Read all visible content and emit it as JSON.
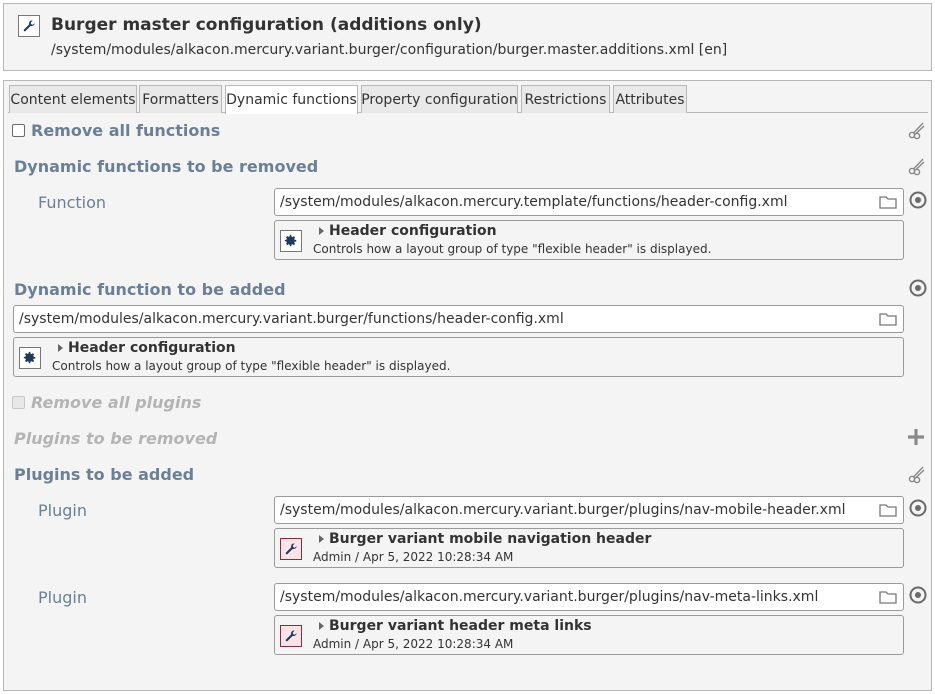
{
  "header": {
    "title": "Burger master configuration (additions only)",
    "path": "/system/modules/alkacon.mercury.variant.burger/configuration/burger.master.additions.xml [en]",
    "icon": "wrench-icon"
  },
  "tabs": [
    {
      "label": "Content elements",
      "active": false
    },
    {
      "label": "Formatters",
      "active": false
    },
    {
      "label": "Dynamic functions",
      "active": true
    },
    {
      "label": "Property configuration",
      "active": false
    },
    {
      "label": "Restrictions",
      "active": false
    },
    {
      "label": "Attributes",
      "active": false
    }
  ],
  "form": {
    "remove_all_functions": {
      "label": "Remove all functions",
      "checked": false
    },
    "functions_removed": {
      "label": "Dynamic functions to be removed",
      "field_label": "Function",
      "value": "/system/modules/alkacon.mercury.template/functions/header-config.xml",
      "preview_title": "Header configuration",
      "preview_sub": "Controls how a layout group of type \"flexible header\" is displayed.",
      "preview_icon": "gear-icon"
    },
    "function_added": {
      "label": "Dynamic function to be added",
      "value": "/system/modules/alkacon.mercury.variant.burger/functions/header-config.xml",
      "preview_title": "Header configuration",
      "preview_sub": "Controls how a layout group of type \"flexible header\" is displayed.",
      "preview_icon": "gear-icon"
    },
    "remove_all_plugins": {
      "label": "Remove all plugins",
      "checked": false,
      "disabled": true
    },
    "plugins_removed": {
      "label": "Plugins to be removed",
      "disabled": true
    },
    "plugins_added": {
      "label": "Plugins to be added",
      "items": [
        {
          "field_label": "Plugin",
          "value": "/system/modules/alkacon.mercury.variant.burger/plugins/nav-mobile-header.xml",
          "preview_title": "Burger variant mobile navigation header",
          "preview_sub": "Admin / Apr 5, 2022 10:28:34 AM",
          "preview_icon": "wrench-icon"
        },
        {
          "field_label": "Plugin",
          "value": "/system/modules/alkacon.mercury.variant.burger/plugins/nav-meta-links.xml",
          "preview_title": "Burger variant header meta links",
          "preview_sub": "Admin / Apr 5, 2022 10:28:34 AM",
          "preview_icon": "wrench-icon"
        }
      ]
    }
  },
  "colors": {
    "label_blue": "#6b7f96",
    "panel_bg": "#f4f4f4",
    "disabled_text": "#b4b4b4",
    "plugin_icon_bg": "#fbe3e8"
  }
}
